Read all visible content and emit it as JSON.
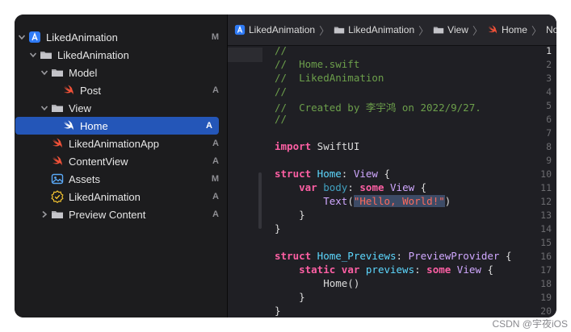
{
  "navigator": {
    "items": [
      {
        "label": "LikedAnimation",
        "status": "M",
        "icon": "project-icon",
        "chevron": "down"
      },
      {
        "label": "LikedAnimation",
        "status": "",
        "icon": "folder-icon",
        "chevron": "down"
      },
      {
        "label": "Model",
        "status": "",
        "icon": "folder-icon",
        "chevron": "down"
      },
      {
        "label": "Post",
        "status": "A",
        "icon": "swift-file-icon",
        "chevron": ""
      },
      {
        "label": "View",
        "status": "",
        "icon": "folder-icon",
        "chevron": "down"
      },
      {
        "label": "Home",
        "status": "A",
        "icon": "swift-file-icon",
        "chevron": "",
        "selected": true
      },
      {
        "label": "LikedAnimationApp",
        "status": "A",
        "icon": "swift-file-icon",
        "chevron": ""
      },
      {
        "label": "ContentView",
        "status": "A",
        "icon": "swift-file-icon",
        "chevron": ""
      },
      {
        "label": "Assets",
        "status": "M",
        "icon": "asset-catalog-icon",
        "chevron": ""
      },
      {
        "label": "LikedAnimation",
        "status": "A",
        "icon": "entitlements-icon",
        "chevron": ""
      },
      {
        "label": "Preview Content",
        "status": "A",
        "icon": "folder-icon",
        "chevron": "right"
      }
    ]
  },
  "jumpbar": {
    "items": [
      "LikedAnimation",
      "LikedAnimation",
      "View",
      "Home",
      "No Selection"
    ]
  },
  "editor": {
    "line_numbers": [
      "1",
      "2",
      "3",
      "4",
      "5",
      "6",
      "7",
      "8",
      "9",
      "10",
      "11",
      "12",
      "13",
      "14",
      "15",
      "16",
      "17",
      "18",
      "19",
      "20"
    ],
    "current_line": 1,
    "code": {
      "l1": "//",
      "l2": "//  Home.swift",
      "l3": "//  LikedAnimation",
      "l4": "//",
      "l5": "//  Created by 李宇鸿 on 2022/9/27.",
      "l6": "//",
      "l8_kw": "import",
      "l8_rest": " SwiftUI",
      "l10_kw": "struct",
      "l10_name": " Home",
      "l10_colon": ": ",
      "l10_type": "View",
      "l10_end": " {",
      "l11_indent": "    ",
      "l11_kw": "var",
      "l11_name": " body",
      "l11_colon": ": ",
      "l11_kw2": "some",
      "l11_type": " View",
      "l11_end": " {",
      "l12_indent": "        ",
      "l12_fn": "Text",
      "l12_open": "(",
      "l12_str": "\"Hello, World!\"",
      "l12_close": ")",
      "l13": "    }",
      "l14": "}",
      "l16_kw": "struct",
      "l16_name": " Home_Previews",
      "l16_colon": ": ",
      "l16_type": "PreviewProvider",
      "l16_end": " {",
      "l17_indent": "    ",
      "l17_kw": "static var",
      "l17_name": " previews",
      "l17_colon": ": ",
      "l17_kw2": "some",
      "l17_type": " View",
      "l17_end": " {",
      "l18": "        Home()",
      "l19": "    }",
      "l20": "}"
    }
  },
  "watermark": "CSDN @宇夜iOS",
  "colors": {
    "selection": "#2456b8",
    "swift_orange": "#f05138",
    "comment": "#6c9f4b",
    "keyword": "#fc5fa3",
    "type": "#5dd8ff"
  }
}
